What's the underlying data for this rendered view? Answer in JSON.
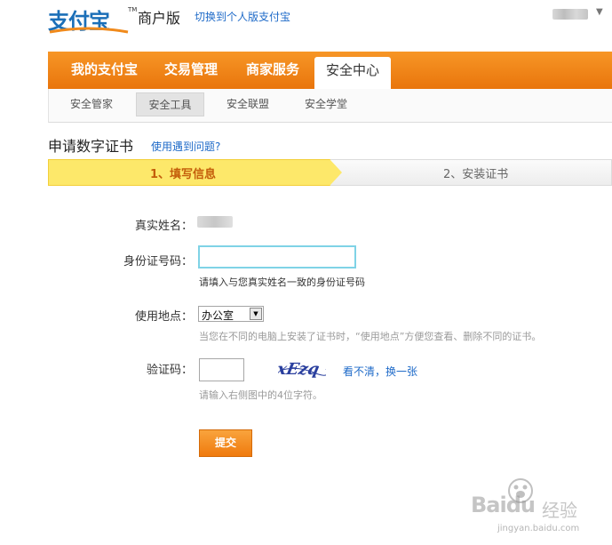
{
  "header": {
    "logo_text": "支付宝",
    "logo_tm": "TM",
    "edition": "商户版",
    "switch_link": "切换到个人版支付宝"
  },
  "main_nav": {
    "tabs": [
      {
        "label": "我的支付宝"
      },
      {
        "label": "交易管理"
      },
      {
        "label": "商家服务"
      },
      {
        "label": "安全中心",
        "active": true
      }
    ]
  },
  "sub_nav": {
    "tabs": [
      {
        "label": "安全管家"
      },
      {
        "label": "安全工具",
        "active": true
      },
      {
        "label": "安全联盟"
      },
      {
        "label": "安全学堂"
      }
    ]
  },
  "page": {
    "title": "申请数字证书",
    "help_link": "使用遇到问题?"
  },
  "steps": [
    {
      "label": "1、填写信息",
      "active": true
    },
    {
      "label": "2、安装证书",
      "active": false
    }
  ],
  "form": {
    "name_label": "真实姓名：",
    "id_label": "身份证号码：",
    "id_value": "",
    "id_hint": "请填入与您真实姓名一致的身份证号码",
    "location_label": "使用地点：",
    "location_value": "办公室",
    "location_hint": "当您在不同的电脑上安装了证书时，“使用地点”方便您查看、删除不同的证书。",
    "captcha_label": "验证码：",
    "captcha_value": "",
    "captcha_text": "xEzq",
    "captcha_refresh": "看不清，换一张",
    "captcha_hint": "请输入右侧图中的4位字符。",
    "submit_label": "提交"
  },
  "watermark": {
    "brand": "Baidu",
    "word": "经验",
    "url": "jingyan.baidu.com"
  },
  "colors": {
    "brand_orange": "#f08a1c",
    "link_blue": "#1e6ac8",
    "step_active_bg": "#fde86a"
  }
}
